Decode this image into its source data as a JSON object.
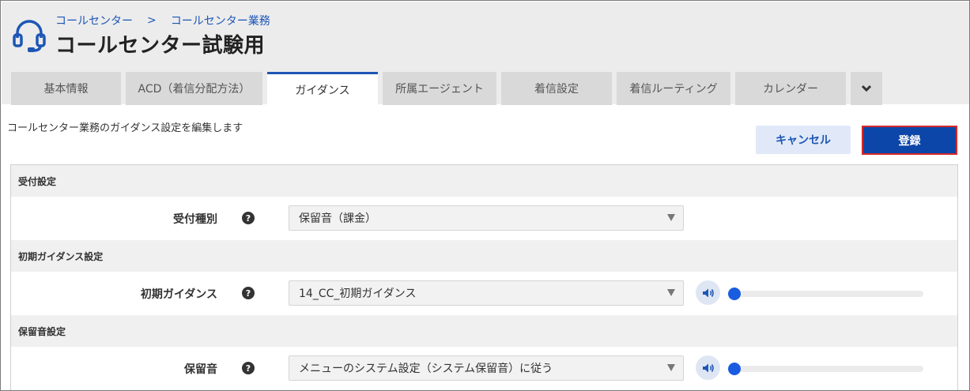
{
  "header": {
    "breadcrumb": [
      "コールセンター",
      "コールセンター業務"
    ],
    "breadcrumb_separator": ">",
    "title": "コールセンター試験用",
    "icon": "headset-icon"
  },
  "tabs": [
    {
      "label": "基本情報",
      "active": false
    },
    {
      "label": "ACD（着信分配方法）",
      "active": false
    },
    {
      "label": "ガイダンス",
      "active": true
    },
    {
      "label": "所属エージェント",
      "active": false
    },
    {
      "label": "着信設定",
      "active": false
    },
    {
      "label": "着信ルーティング",
      "active": false
    },
    {
      "label": "カレンダー",
      "active": false
    }
  ],
  "tabs_more_icon": "chevron-down-icon",
  "description": "コールセンター業務のガイダンス設定を編集します",
  "actions": {
    "cancel_label": "キャンセル",
    "save_label": "登録"
  },
  "sections": [
    {
      "title": "受付設定",
      "rows": [
        {
          "label": "受付種別",
          "help": "?",
          "value": "保留音（課金）",
          "has_audio": false
        }
      ]
    },
    {
      "title": "初期ガイダンス設定",
      "rows": [
        {
          "label": "初期ガイダンス",
          "help": "?",
          "value": "14_CC_初期ガイダンス",
          "has_audio": true,
          "volume": 0
        }
      ]
    },
    {
      "title": "保留音設定",
      "rows": [
        {
          "label": "保留音",
          "help": "?",
          "value": "メニューのシステム設定（システム保留音）に従う",
          "has_audio": true,
          "volume": 0
        }
      ]
    }
  ],
  "colors": {
    "accent": "#1d56b5",
    "primary_button": "#0c46a8",
    "primary_button_border": "#d42a2a",
    "slider_thumb": "#1a5ce0"
  }
}
